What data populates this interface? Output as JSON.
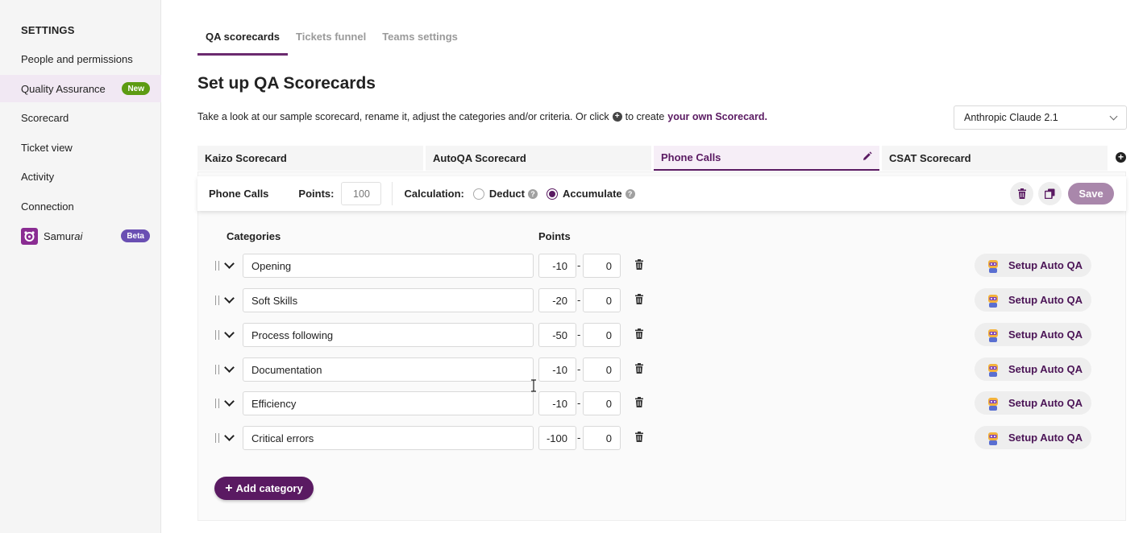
{
  "sidebar": {
    "heading": "SETTINGS",
    "items": [
      {
        "label": "People and permissions"
      },
      {
        "label": "Quality Assurance",
        "badge": "New"
      },
      {
        "label": "Scorecard"
      },
      {
        "label": "Ticket view"
      },
      {
        "label": "Activity"
      },
      {
        "label": "Connection"
      },
      {
        "label_prefix": "Samur",
        "label_suffix": "ai",
        "badge": "Beta"
      }
    ]
  },
  "tabs": [
    {
      "label": "QA scorecards"
    },
    {
      "label": "Tickets funnel"
    },
    {
      "label": "Teams settings"
    }
  ],
  "page": {
    "title": "Set up QA Scorecards",
    "intro_before": "Take a look at our sample scorecard, rename it, adjust the categories and/or criteria. Or click",
    "intro_after": "to create",
    "intro_link": "your own Scorecard."
  },
  "model_select": {
    "value": "Anthropic Claude 2.1"
  },
  "scorecards": [
    {
      "label": "Kaizo Scorecard"
    },
    {
      "label": "AutoQA Scorecard"
    },
    {
      "label": "Phone Calls"
    },
    {
      "label": "CSAT Scorecard"
    }
  ],
  "toolbar": {
    "name": "Phone Calls",
    "points_label": "Points:",
    "points_value": "100",
    "calc_label": "Calculation:",
    "deduct_label": "Deduct",
    "accumulate_label": "Accumulate",
    "selected": "Accumulate",
    "save_label": "Save"
  },
  "table": {
    "col_categories": "Categories",
    "col_points": "Points",
    "dash": "-",
    "rows": [
      {
        "category": "Opening",
        "min": "-10",
        "max": "0",
        "action": "Setup Auto QA"
      },
      {
        "category": "Soft Skills",
        "min": "-20",
        "max": "0",
        "action": "Setup Auto QA"
      },
      {
        "category": "Process following",
        "min": "-50",
        "max": "0",
        "action": "Setup Auto QA"
      },
      {
        "category": "Documentation",
        "min": "-10",
        "max": "0",
        "action": "Setup Auto QA"
      },
      {
        "category": "Efficiency",
        "min": "-10",
        "max": "0",
        "action": "Setup Auto QA"
      },
      {
        "category": "Critical errors",
        "min": "-100",
        "max": "0",
        "action": "Setup Auto QA"
      }
    ]
  },
  "add_category_label": "Add category",
  "colors": {
    "accent": "#5a1a62",
    "save_disabled": "#a987ab",
    "new_badge": "#5c9b12",
    "beta_badge": "#6a4fb3"
  }
}
